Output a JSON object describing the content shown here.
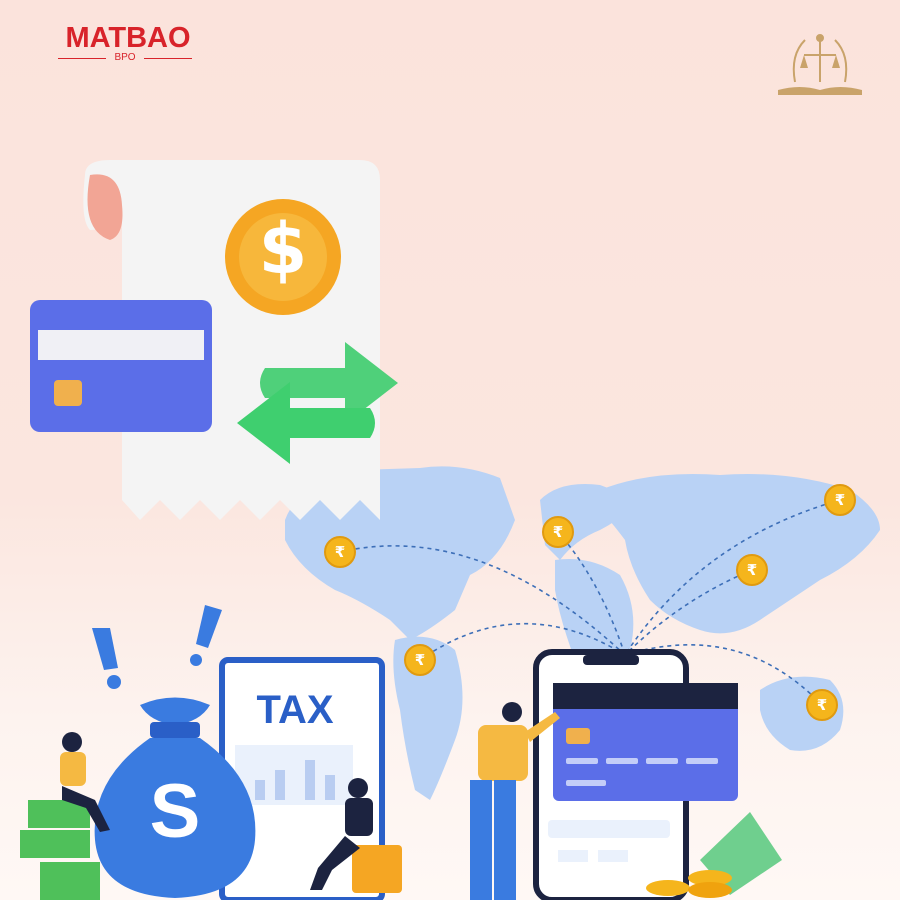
{
  "brand": {
    "logo_text": "MATBAO",
    "logo_subtext": "BPO",
    "emblem": "scales-of-justice-on-book-emblem"
  },
  "illustration": {
    "tax_form_label": "TAX",
    "money_bag_symbol": "S",
    "coin_symbol": "$",
    "currency_coin_symbol": "₹"
  },
  "icons": [
    "receipt-icon",
    "credit-card-icon",
    "dollar-coin-icon",
    "transfer-arrows-icon",
    "world-map-icon",
    "rupee-coin-icon",
    "money-bag-icon",
    "tax-form-icon",
    "smartphone-icon",
    "cash-icon"
  ],
  "colors": {
    "background": "#fbe4dd",
    "brand_red": "#d8232a",
    "emblem_gold": "#c9a36a",
    "card_blue": "#5b6ee8",
    "arrow_green": "#4fd07a",
    "coin_orange": "#f5a623",
    "map_blue": "#b9d2f5",
    "bag_blue": "#3a7be0"
  }
}
